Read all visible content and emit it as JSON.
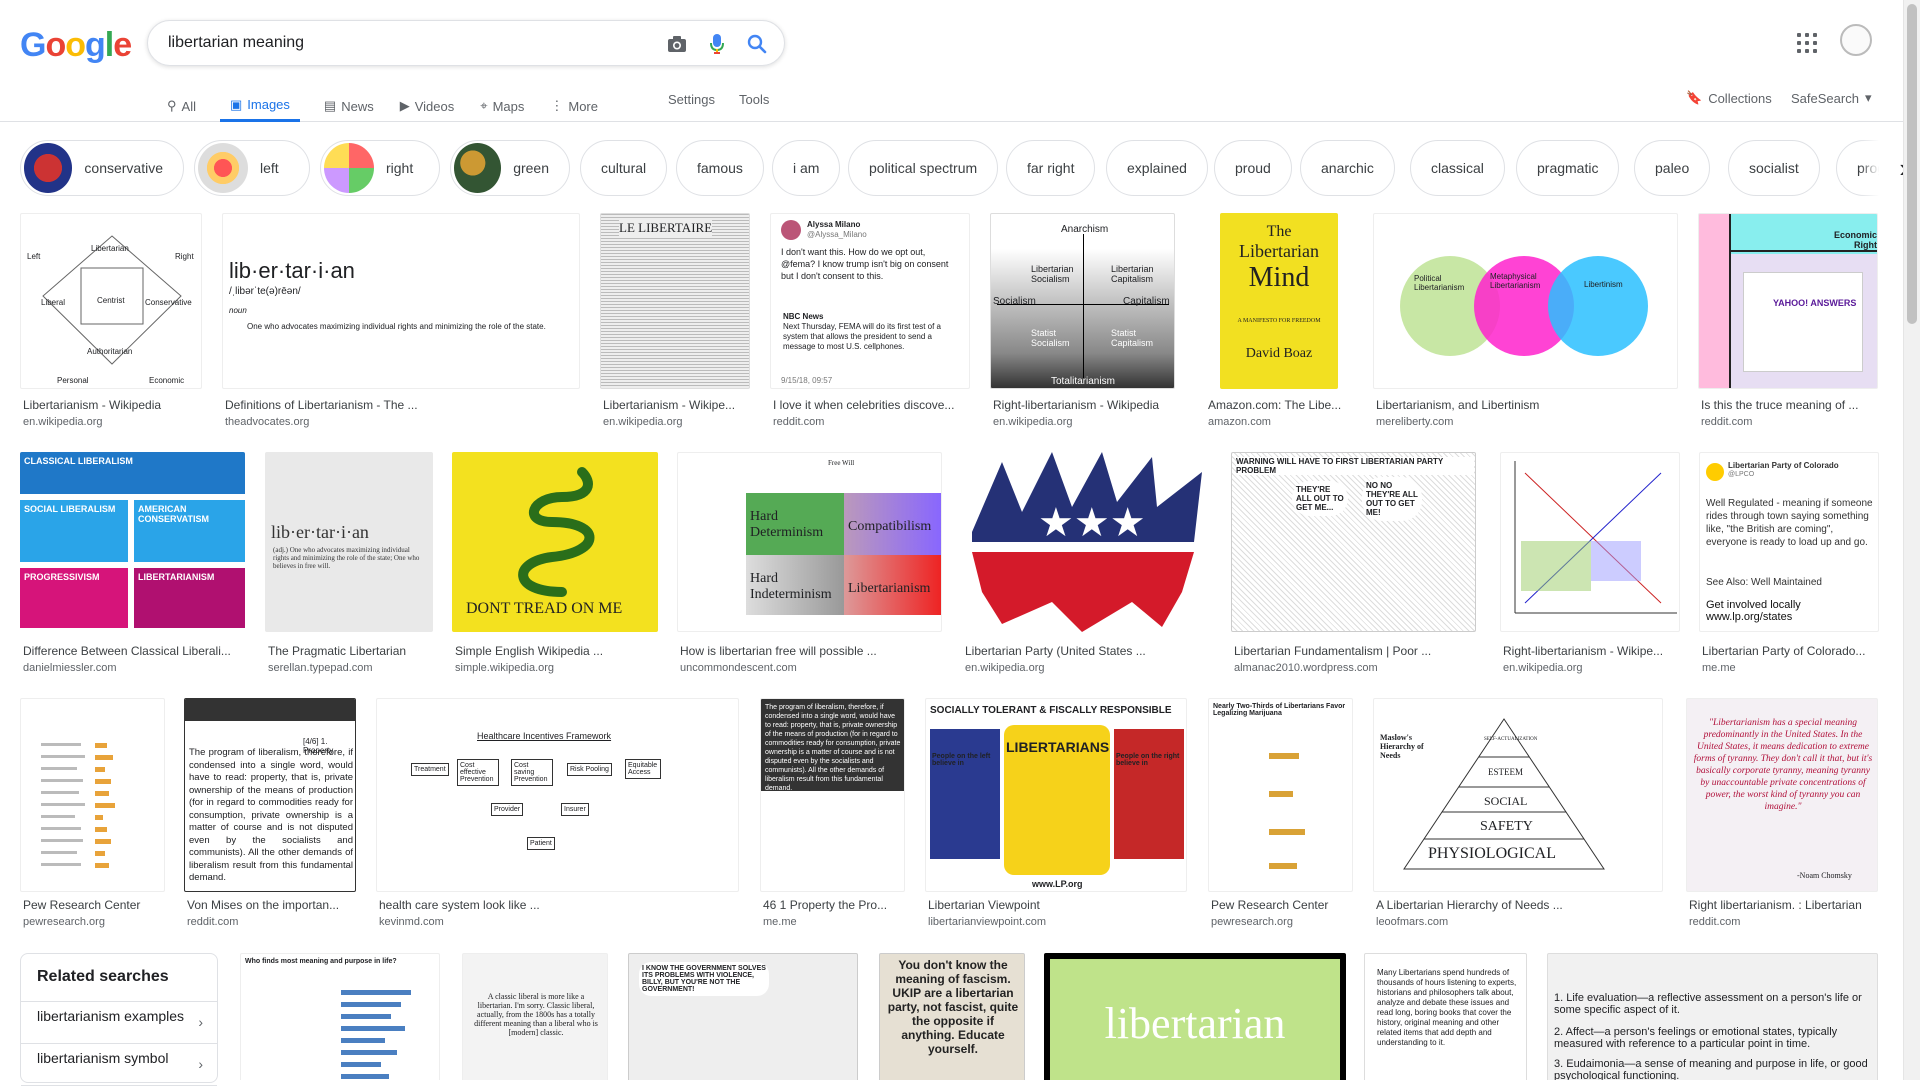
{
  "search": {
    "query": "libertarian meaning"
  },
  "logo": [
    "G",
    "o",
    "o",
    "g",
    "l",
    "e"
  ],
  "tabs": [
    {
      "label": "All",
      "icon": "search-icon"
    },
    {
      "label": "Images",
      "icon": "image-icon"
    },
    {
      "label": "News",
      "icon": "news-icon"
    },
    {
      "label": "Videos",
      "icon": "video-icon"
    },
    {
      "label": "Maps",
      "icon": "map-icon"
    },
    {
      "label": "More",
      "icon": "more-vert-icon"
    }
  ],
  "tools": {
    "settings": "Settings",
    "tools": "Tools"
  },
  "right": {
    "collections": "Collections",
    "safesearch": "SafeSearch"
  },
  "chips": [
    {
      "label": "conservative"
    },
    {
      "label": "left"
    },
    {
      "label": "right"
    },
    {
      "label": "green"
    },
    {
      "label": "cultural"
    },
    {
      "label": "famous"
    },
    {
      "label": "i am"
    },
    {
      "label": "political spectrum"
    },
    {
      "label": "far right"
    },
    {
      "label": "explained"
    },
    {
      "label": "proud"
    },
    {
      "label": "anarchic"
    },
    {
      "label": "classical"
    },
    {
      "label": "pragmatic"
    },
    {
      "label": "paleo"
    },
    {
      "label": "socialist"
    },
    {
      "label": "progressiv"
    }
  ],
  "results": [
    {
      "title": "Libertarianism - Wikipedia",
      "site": "en.wikipedia.org"
    },
    {
      "title": "Definitions of Libertarianism - The ...",
      "site": "theadvocates.org"
    },
    {
      "title": "Libertarianism - Wikipe...",
      "site": "en.wikipedia.org"
    },
    {
      "title": "I love it when celebrities discove...",
      "site": "reddit.com"
    },
    {
      "title": "Right-libertarianism - Wikipedia",
      "site": "en.wikipedia.org"
    },
    {
      "title": "Amazon.com: The Libe...",
      "site": "amazon.com"
    },
    {
      "title": "Libertarianism, and Libertinism",
      "site": "mereliberty.com"
    },
    {
      "title": "Is this the truce meaning of ...",
      "site": "reddit.com"
    },
    {
      "title": "Difference Between Classical Liberali...",
      "site": "danielmiessler.com"
    },
    {
      "title": "The Pragmatic Libertarian",
      "site": "serellan.typepad.com"
    },
    {
      "title": "Simple English Wikipedia ...",
      "site": "simple.wikipedia.org"
    },
    {
      "title": "How is libertarian free will possible ...",
      "site": "uncommondescent.com"
    },
    {
      "title": "Libertarian Party (United States ...",
      "site": "en.wikipedia.org"
    },
    {
      "title": "Libertarian Fundamentalism | Poor ...",
      "site": "almanac2010.wordpress.com"
    },
    {
      "title": "Right-libertarianism - Wikipe...",
      "site": "en.wikipedia.org"
    },
    {
      "title": "Libertarian Party of Colorado...",
      "site": "me.me"
    },
    {
      "title": "Pew Research Center",
      "site": "pewresearch.org"
    },
    {
      "title": "Von Mises on the importan...",
      "site": "reddit.com"
    },
    {
      "title": "health care system look like ...",
      "site": "kevinmd.com"
    },
    {
      "title": "46 1 Property the Pro...",
      "site": "me.me"
    },
    {
      "title": "Libertarian Viewpoint",
      "site": "libertarianviewpoint.com"
    },
    {
      "title": "Pew Research Center",
      "site": "pewresearch.org"
    },
    {
      "title": "A Libertarian Hierarchy of Needs ...",
      "site": "leoofmars.com"
    },
    {
      "title": "Right libertarianism. : Libertarian",
      "site": "reddit.com"
    }
  ],
  "images": {
    "wiki_diamond": {
      "top": "Libertarian",
      "left": "Left",
      "right": "Right",
      "center": "Centrist",
      "liberal": "Liberal",
      "conservative": "Conservative",
      "bottom": "Authoritarian",
      "personal": "Personal",
      "economic": "Economic"
    },
    "definition": {
      "word": "lib·er·tar·i·an",
      "pron": "/ˌlibərˈte(ə)rēən/",
      "pos": "noun",
      "def": "One who advocates maximizing individual rights and minimizing the role of the state."
    },
    "newspaper": {
      "masthead": "LE LIBERTAIRE"
    },
    "tweet": {
      "name": "Alyssa Milano",
      "handle": "@Alyssa_Milano",
      "text": "I don't want this. How do we opt out, @fema? I know trump isn't big on consent but I don't consent to this.",
      "news": "NBC News",
      "news_text": "Next Thursday, FEMA will do its first test of a system that allows the president to send a message to most U.S. cellphones.",
      "date": "9/15/18, 09:57"
    },
    "quadrant": {
      "top": "Anarchism",
      "bottom": "Totalitarianism",
      "left": "Socialism",
      "right": "Capitalism",
      "tl": "Libertarian Socialism",
      "tr": "Libertarian Capitalism",
      "bl": "Statist Socialism",
      "br": "Statist Capitalism"
    },
    "book": {
      "l1": "The",
      "l2": "Libertarian",
      "l3": "Mind",
      "sub": "A MANIFESTO FOR FREEDOM",
      "author": "David Boaz"
    },
    "venn": {
      "a": "Political Libertarianism",
      "b": "Metaphysical Libertarianism",
      "c": "Libertinism"
    },
    "axis": {
      "label": "Economic Right",
      "site": "YAHOO! ANSWERS"
    },
    "classical": {
      "a": "CLASSICAL LIBERALISM",
      "b": "SOCIAL LIBERALISM",
      "c": "AMERICAN CONSERVATISM",
      "d": "PROGRESSIVISM",
      "e": "LIBERTARIANISM"
    },
    "pragmatic": {
      "word": "lib·er·tar·i·an",
      "def": "(adj.) One who advocates maximizing individual rights and minimizing the role of the state; One who believes in free will."
    },
    "gadsden": {
      "text": "DONT TREAD ON ME"
    },
    "freewill": {
      "top": "Free Will",
      "hd": "Hard Determinism",
      "comp": "Compatibilism",
      "hi": "Hard Indeterminism",
      "lib": "Libertarianism"
    },
    "cartoon": {
      "banner": "WARNING WILL HAVE TO FIRST LIBERTARIAN PARTY PROBLEM",
      "b1": "THEY'RE ALL OUT TO GET ME...",
      "b2": "NO NO THEY'RE ALL OUT TO GET ME!"
    },
    "lpco": {
      "name": "Libertarian Party of Colorado",
      "handle": "@LPCO",
      "text": "Well Regulated - meaning if someone rides through town saying something like, \"the British are coming\", everyone is ready to load up and go.",
      "see": "See Also: Well Maintained",
      "cta": "Get involved locally www.lp.org/states"
    },
    "mises": {
      "head": "[4/6] 1. Property",
      "text": "The program of liberalism, therefore, if condensed into a single word, would have to read: property, that is, private ownership of the means of production (for in regard to commodities ready for consumption, private ownership is a matter of course and is not disputed even by the socialists and communists). All the other demands of liberalism result from this fundamental demand."
    },
    "health": {
      "title": "Healthcare Incentives Framework",
      "nodes": [
        "Treatment",
        "Cost effective Prevention",
        "Cost saving Prevention",
        "Risk Pooling",
        "Equitable Access",
        "Provider",
        "Insurer",
        "Patient"
      ]
    },
    "viewpoint": {
      "banner": "SOCIALLY TOLERANT & FISCALLY RESPONSIBLE",
      "center": "LIBERTARIANS",
      "left": "People on the left believe in",
      "right": "People on the right believe in",
      "url": "www.LP.org"
    },
    "pew2": {
      "title": "Nearly Two-Thirds of Libertarians Favor Legalizing Marijuana"
    },
    "maslow": {
      "title": "Maslow's Hierarchy of Needs",
      "levels": [
        "SELF-ACTUALIZATION",
        "ESTEEM",
        "SOCIAL",
        "SAFETY",
        "PHYSIOLOGICAL"
      ]
    },
    "chomsky": {
      "quote": "\"Libertarianism has a special meaning predominantly in the United States. In the United States, it means dedication to extreme forms of tyranny. They don't call it that, but it's basically corporate tyranny, meaning tyranny by unaccountable private concentrations of power, the worst kind of tyranny you can imagine.\"",
      "author": "-Noam Chomsky"
    },
    "row4": {
      "pew3": "Who finds most meaning and purpose in life?",
      "classic": "A classic liberal is more like a libertarian. I'm sorry. Classic liberal, actually, from the 1800s has a totally different meaning than a liberal who is [modern] classic.",
      "comic": "I KNOW THE GOVERNMENT SOLVES ITS PROBLEMS WITH VIOLENCE, BILLY, BUT YOU'RE NOT THE GOVERNMENT!",
      "ukip": "You don't know the meaning of fascism. UKIP are a libertarian party, not fascist, quite the opposite if anything. Educate yourself.",
      "word": "libertarian",
      "text": "Many Libertarians spend hundreds of thousands of hours listening to experts, historians and philosophers talk about, analyze and debate these issues and read long, boring books that cover the history, original meaning and other related items that add depth and understanding to it.",
      "list": [
        "1. Life evaluation—a reflective assessment on a person's life or some specific aspect of it.",
        "2. Affect—a person's feelings or emotional states, typically measured with reference to a particular point in time.",
        "3. Eudaimonia—a sense of meaning and purpose in life, or good psychological functioning."
      ]
    }
  },
  "related": {
    "title": "Related searches",
    "items": [
      "libertarianism examples",
      "libertarianism symbol"
    ]
  }
}
